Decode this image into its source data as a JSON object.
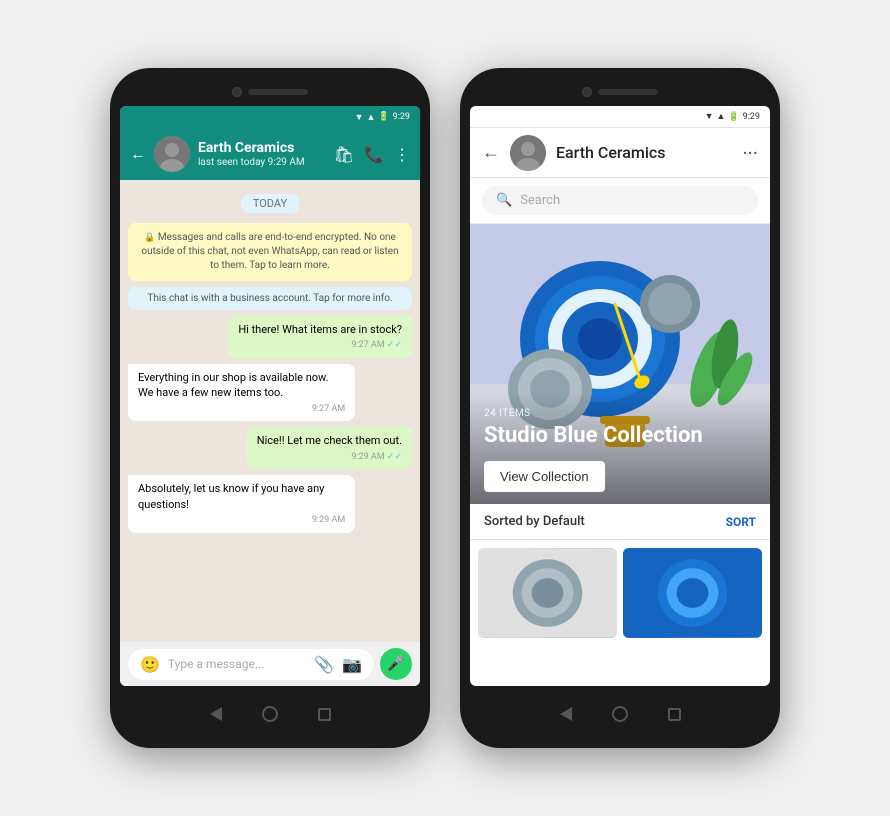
{
  "phone1": {
    "status_time": "9:29",
    "header": {
      "name": "Earth Ceramics",
      "status": "last seen today 9:29 AM"
    },
    "date_badge": "TODAY",
    "encryption_msg": "🔒 Messages and calls are end-to-end encrypted. No one outside of this chat, not even WhatsApp, can read or listen to them. Tap to learn more.",
    "business_notice": "This chat is with a business account. Tap for more info.",
    "messages": [
      {
        "type": "sent",
        "text": "Hi there! What items are in stock?",
        "time": "9:27 AM",
        "check": true
      },
      {
        "type": "received",
        "text": "Everything in our shop is available now. We have a few new items too.",
        "time": "9:27 AM"
      },
      {
        "type": "sent",
        "text": "Nice!! Let me check them out.",
        "time": "9:29 AM",
        "check": true
      },
      {
        "type": "received",
        "text": "Absolutely, let us know if you have any questions!",
        "time": "9:29 AM"
      }
    ],
    "input_placeholder": "Type a message..."
  },
  "phone2": {
    "status_time": "9:29",
    "header": {
      "name": "Earth Ceramics"
    },
    "search_placeholder": "Search",
    "hero": {
      "items_count": "24 ITEMS",
      "collection_name": "Studio Blue Collection",
      "btn_label": "View Collection"
    },
    "sort_bar": {
      "label": "Sorted by Default",
      "btn": "SORT"
    }
  }
}
